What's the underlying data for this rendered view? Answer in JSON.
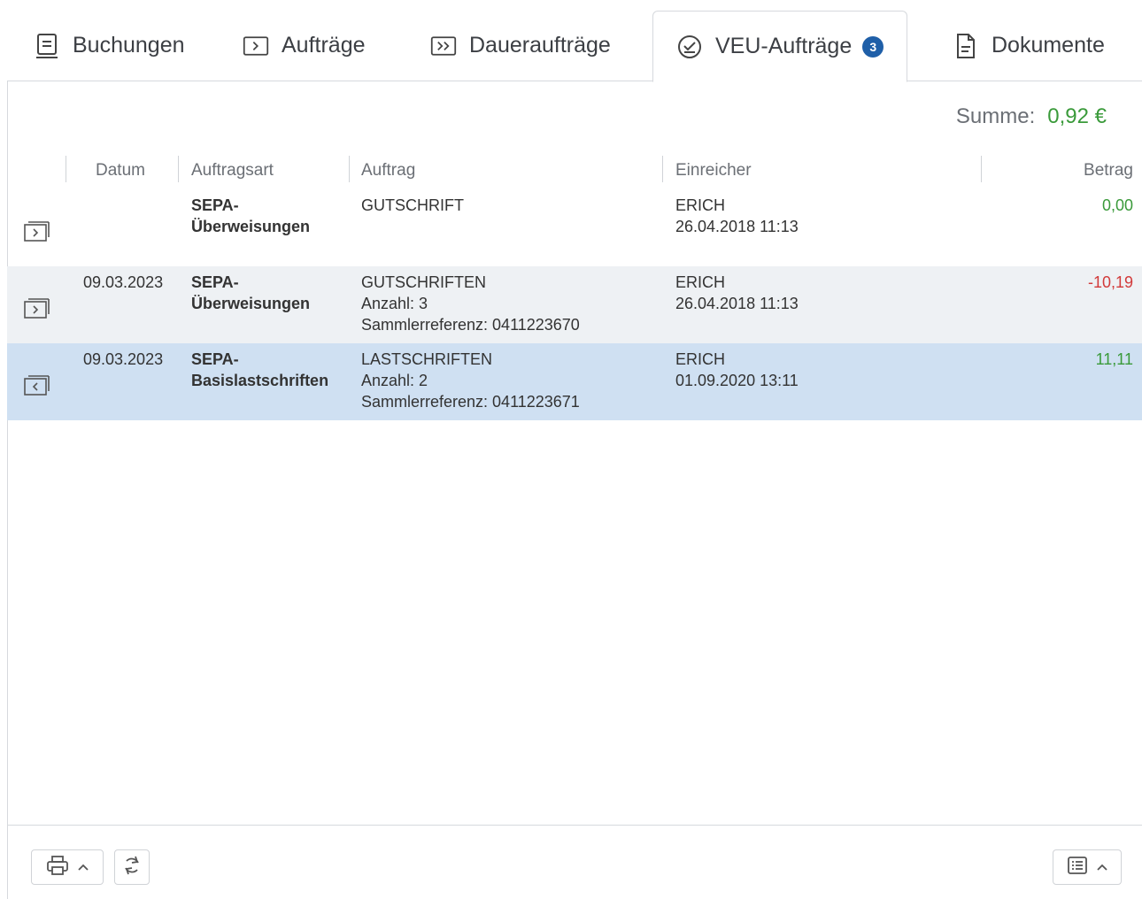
{
  "tabs": [
    {
      "label": "Buchungen",
      "icon": "ledger-icon",
      "active": false
    },
    {
      "label": "Aufträge",
      "icon": "order-icon",
      "active": false
    },
    {
      "label": "Daueraufträge",
      "icon": "standing-order-icon",
      "active": false
    },
    {
      "label": "VEU-Aufträge",
      "icon": "check-circle-icon",
      "active": true,
      "badge": "3"
    },
    {
      "label": "Dokumente",
      "icon": "document-icon",
      "active": false
    }
  ],
  "summary": {
    "label": "Summe:",
    "value": "0,92 €"
  },
  "columns": {
    "datum": "Datum",
    "auftragsart": "Auftragsart",
    "auftrag": "Auftrag",
    "einreicher": "Einreicher",
    "betrag": "Betrag"
  },
  "rows": [
    {
      "icon": "outgoing-transfer-icon",
      "datum": "",
      "auftragsart": [
        "SEPA-",
        "Überweisungen"
      ],
      "auftrag": [
        "GUTSCHRIFT"
      ],
      "einreicher": [
        "ERICH",
        "26.04.2018 11:13"
      ],
      "betrag": "0,00",
      "sign": "pos"
    },
    {
      "icon": "outgoing-transfer-icon",
      "datum": "09.03.2023",
      "auftragsart": [
        "SEPA-",
        "Überweisungen"
      ],
      "auftrag": [
        "GUTSCHRIFTEN",
        "Anzahl: 3",
        "Sammlerreferenz: 0411223670"
      ],
      "einreicher": [
        "ERICH",
        "26.04.2018 11:13"
      ],
      "betrag": "-10,19",
      "sign": "neg"
    },
    {
      "icon": "incoming-debit-icon",
      "datum": "09.03.2023",
      "auftragsart": [
        "SEPA-",
        "Basislastschriften"
      ],
      "auftrag": [
        "LASTSCHRIFTEN",
        "Anzahl: 2",
        "Sammlerreferenz: 0411223671"
      ],
      "einreicher": [
        "ERICH",
        "01.09.2020 13:11"
      ],
      "betrag": "11,11",
      "sign": "pos",
      "selected": true
    }
  ],
  "footer": {
    "print_icon": "printer-icon",
    "refresh_icon": "refresh-icon",
    "view_icon": "list-view-icon"
  },
  "colors": {
    "accent": "#1f5fa8",
    "positive": "#3a9a3a",
    "negative": "#d23a3a",
    "selected_row": "#cfe0f2"
  }
}
